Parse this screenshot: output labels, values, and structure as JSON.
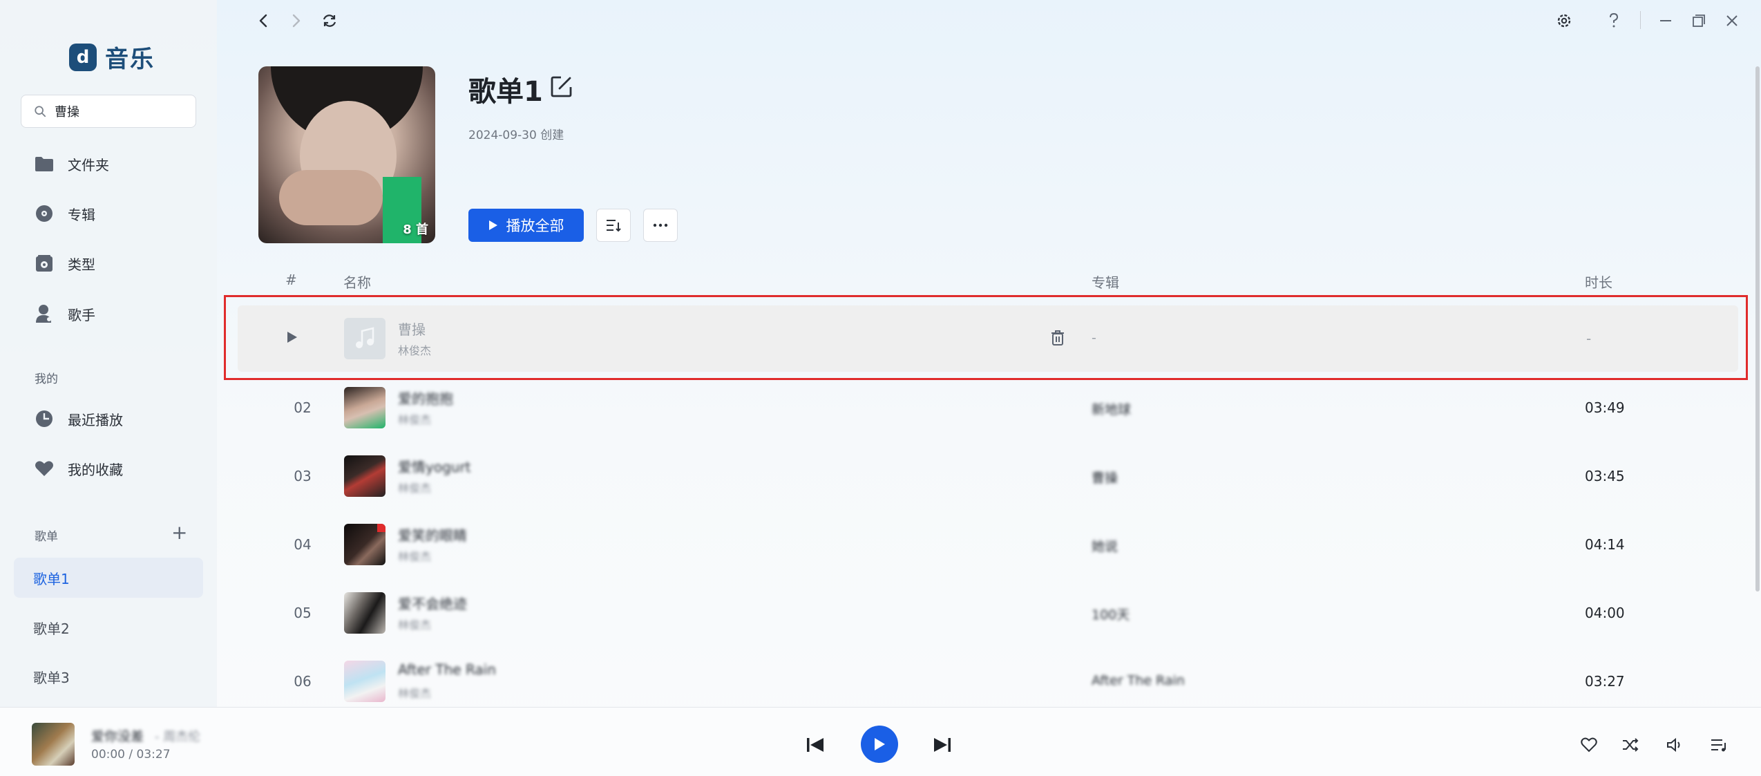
{
  "app": {
    "name": "音乐",
    "logo_glyph": "d"
  },
  "search": {
    "value": "曹操",
    "placeholder": ""
  },
  "nav": [
    {
      "label": "文件夹",
      "icon": "folder-icon"
    },
    {
      "label": "专辑",
      "icon": "disc-icon"
    },
    {
      "label": "类型",
      "icon": "genre-icon"
    },
    {
      "label": "歌手",
      "icon": "singer-icon"
    }
  ],
  "mine": {
    "label": "我的",
    "items": [
      {
        "label": "最近播放",
        "icon": "clock-icon"
      },
      {
        "label": "我的收藏",
        "icon": "heart-icon"
      }
    ]
  },
  "playlists": {
    "label": "歌单",
    "add_glyph": "+",
    "items": [
      {
        "label": "歌单1",
        "active": true
      },
      {
        "label": "歌单2",
        "active": false
      },
      {
        "label": "歌单3",
        "active": false
      }
    ]
  },
  "header": {
    "title": "歌单1",
    "created": "2024-09-30 创建",
    "count": "8 首",
    "play_all": "播放全部"
  },
  "table": {
    "headers": {
      "num": "#",
      "name": "名称",
      "album": "专辑",
      "duration": "时长"
    },
    "rows": [
      {
        "num": "",
        "title": "曹操",
        "artist": "林俊杰",
        "album": "-",
        "duration": "-",
        "thumb": "placeholder"
      },
      {
        "num": "02",
        "title": "爱的抱抱",
        "artist": "林俊杰",
        "album": "新地球",
        "duration": "03:49",
        "thumb": "portrait-green"
      },
      {
        "num": "03",
        "title": "爱情yogurt",
        "artist": "林俊杰",
        "album": "曹操",
        "duration": "03:45",
        "thumb": "dark-stage"
      },
      {
        "num": "04",
        "title": "爱笑的眼睛",
        "artist": "林俊杰",
        "album": "她说",
        "duration": "04:14",
        "thumb": "dark-red"
      },
      {
        "num": "05",
        "title": "爱不会绝迹",
        "artist": "林俊杰",
        "album": "100天",
        "duration": "04:00",
        "thumb": "bw-portrait"
      },
      {
        "num": "06",
        "title": "After The Rain",
        "artist": "林俊杰",
        "album": "After The Rain",
        "duration": "03:27",
        "thumb": "pastel"
      }
    ]
  },
  "player": {
    "title": "爱你没差",
    "artist": "- 周杰伦",
    "time": "00:00 / 03:27"
  },
  "colors": {
    "accent": "#1a5fe6",
    "highlight_border": "#e02c2c",
    "brand": "#1d4e7a"
  }
}
